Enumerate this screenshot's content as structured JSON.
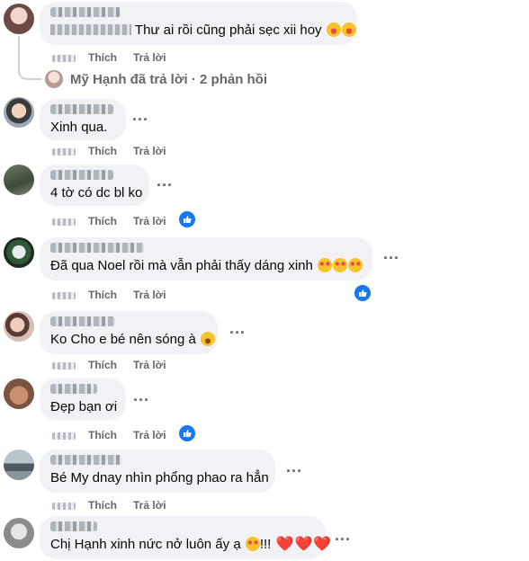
{
  "comments": [
    {
      "text": "Thư ai rồi cũng phải sẹc xii hoy",
      "emojis": [
        "laugh",
        "laugh"
      ],
      "like": "Thích",
      "reply": "Trả lời",
      "liked": false
    },
    {
      "text": "Xinh qua.",
      "emojis": [],
      "like": "Thích",
      "reply": "Trả lời",
      "liked": false
    },
    {
      "text": "4 tờ có dc bl ko",
      "emojis": [],
      "like": "Thích",
      "reply": "Trả lời",
      "liked": true
    },
    {
      "text": "Đã qua Noel rồi mà vẫn phải thấy dáng xinh",
      "emojis": [
        "love",
        "love",
        "love"
      ],
      "like": "Thích",
      "reply": "Trả lời",
      "liked": true
    },
    {
      "text": "Ko Cho e bé nên sóng à",
      "emojis": [
        "smile"
      ],
      "like": "Thích",
      "reply": "Trả lời",
      "liked": false
    },
    {
      "text": "Đẹp bạn ơi",
      "emojis": [],
      "like": "Thích",
      "reply": "Trả lời",
      "liked": true
    },
    {
      "text": "Bé My dnay nhìn phổng phao ra hẳn",
      "emojis": [],
      "like": "Thích",
      "reply": "Trả lời",
      "liked": false
    },
    {
      "text": "Chị Hạnh xinh nức nở luôn ấy ạ",
      "trailing": "!!!",
      "emojis": [
        "love"
      ],
      "hearts": [
        "❤️",
        "❤️",
        "❤️"
      ],
      "like": "Thích",
      "reply": "Trả lời",
      "liked": false
    }
  ],
  "reply_summary": "Mỹ Hạnh đã trả lời · 2 phản hồi",
  "more_options": "...",
  "icons": {
    "like_badge": "thumbs-up-icon",
    "like_badge_color": "#1877f2"
  }
}
